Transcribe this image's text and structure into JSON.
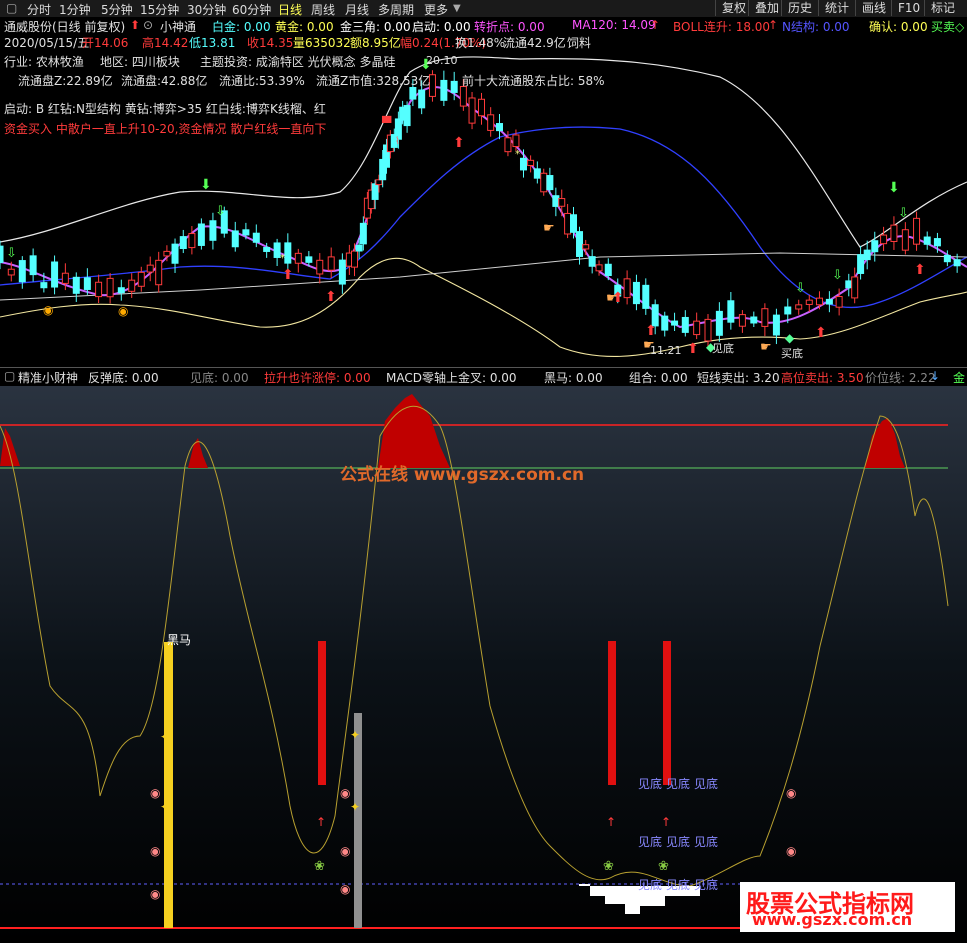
{
  "topbar": {
    "periods": [
      "分时",
      "1分钟",
      "5分钟",
      "15分钟",
      "30分钟",
      "60分钟",
      "日线",
      "周线",
      "月线",
      "多周期",
      "更多"
    ],
    "active_period": "日线",
    "right_buttons": [
      "复权",
      "叠加",
      "历史",
      "统计",
      "画线",
      "F10",
      "标记"
    ]
  },
  "info": {
    "stock": "通威股份(日线 前复权)",
    "indicator": "小神通",
    "baijin": "白金: 0.00",
    "huangjin": "黄金: 0.00",
    "jinsanjiao": "金三角: 0.00",
    "qidong": "启动: 0.00",
    "zhuanzhedian": "转折点: 0.00",
    "ma120": "MA120: 14.09",
    "boll": "BOLL连升: 18.00",
    "njiegou": "N结构: 0.00",
    "queren": "确认: 0.00",
    "maidong": "买卖◇"
  },
  "quote": {
    "date": "2020/05/15/五",
    "open": "开14.06",
    "high": "高14.42",
    "low": "低13.81",
    "close": "收14.35",
    "volume": "量635032",
    "amount": "额8.95亿",
    "change": "幅0.24(1.70%)",
    "turnover": "换1.48%",
    "float_cap": "流通42.9亿",
    "feed": "饲料"
  },
  "profile": {
    "industry": "行业: 农林牧渔",
    "region": "地区: 四川板块",
    "theme": "主题投资: 成渝特区 光伏概念 多晶硅",
    "float_z": "流通盘Z:22.89亿",
    "float": "流通盘:42.88亿",
    "float_ratio": "流通比:53.39%",
    "float_z_value": "流通Z市值:328.53亿",
    "top10": "前十大流通股东占比: 58%",
    "signals": "启动: B  红钻:N型结构  黄钻:博弈>35  红白线:博弈K线榴、红",
    "funds": "资金买入  中散户一直上升10-20,资金情况 散户红线一直向下"
  },
  "chart_labels": {
    "high_price": "20.10",
    "low_price": "11.21",
    "buy_label": "买底",
    "bottom_label": "见底"
  },
  "lower_bar": {
    "name": "精准小财神",
    "fantandi": "反弹底: 0.00",
    "jiandi": "见底: 0.00",
    "lashen": "拉升也许涨停: 0.00",
    "macd": "MACD零轴上金叉: 0.00",
    "heima": "黑马: 0.00",
    "zuhe": "组合: 0.00",
    "duanxian": "短线卖出: 3.20",
    "gaowei": "高位卖出: 3.50",
    "jiawei": "价位线: 2.22",
    "jin": "金"
  },
  "lower_labels": {
    "heima": "黑马",
    "jiandi": "见底"
  },
  "watermark": {
    "site": "公式在线  www.gszx.com.cn",
    "brand": "股票公式指标网",
    "brand_url": "www.gszx.com.cn"
  },
  "colors": {
    "up": "#ff3b3b",
    "down": "#54ffff",
    "ma_purple": "#c860ff",
    "boll_white": "#e8e8e8",
    "boll_yellow": "#f2e6a0",
    "ma_blue": "#3040ff",
    "osc_line": "#b8a030",
    "red_fill": "#c00000",
    "threshold_green": "#60d060"
  }
}
